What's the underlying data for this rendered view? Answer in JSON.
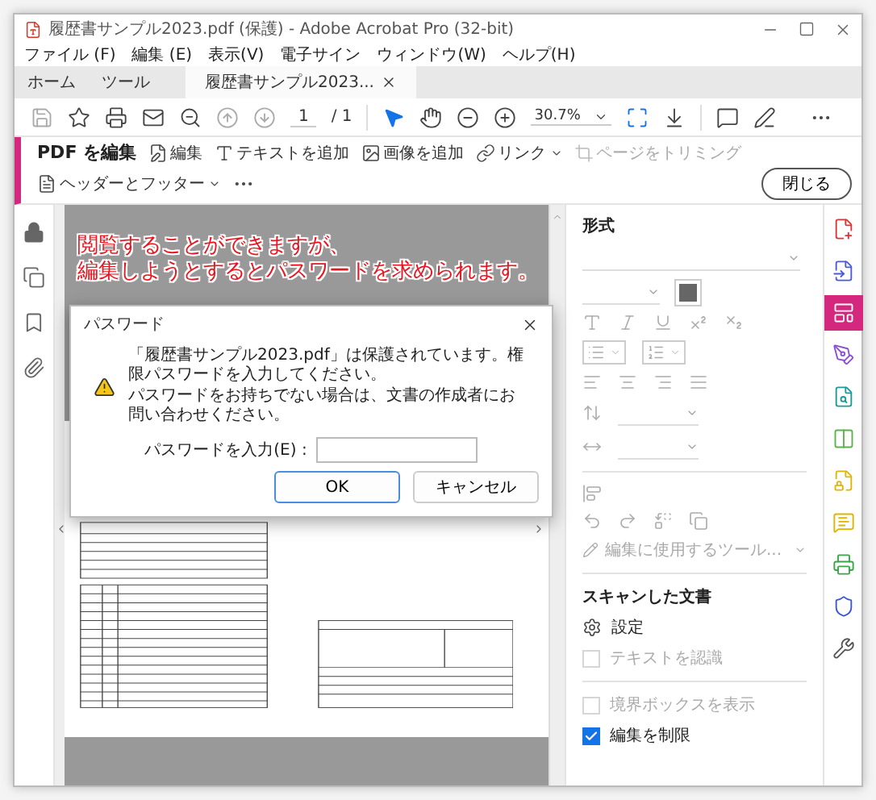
{
  "window": {
    "title": "履歴書サンプル2023.pdf (保護) - Adobe Acrobat Pro (32-bit)"
  },
  "menu": [
    "ファイル (F)",
    "編集 (E)",
    "表示(V)",
    "電子サイン",
    "ウィンドウ(W)",
    "ヘルプ(H)"
  ],
  "tabs": [
    {
      "kind": "nav",
      "label": "ホーム",
      "selected": false
    },
    {
      "kind": "nav",
      "label": "ツール",
      "selected": false
    },
    {
      "kind": "document",
      "label": "履歴書サンプル2023...",
      "selected": true
    }
  ],
  "toolbar": {
    "page": "1",
    "page_total": "/ 1",
    "zoom": "30.7%"
  },
  "edit_toolbar": {
    "title": "PDF を編集",
    "tools": [
      {
        "kind": "edit",
        "label": "編集",
        "disabled": false,
        "dropdown": false
      },
      {
        "kind": "text",
        "label": "テキストを追加",
        "disabled": false,
        "dropdown": false
      },
      {
        "kind": "image",
        "label": "画像を追加",
        "disabled": false,
        "dropdown": false
      },
      {
        "kind": "link",
        "label": "リンク",
        "disabled": false,
        "dropdown": true
      },
      {
        "kind": "crop",
        "label": "ページをトリミング",
        "disabled": true,
        "dropdown": false
      },
      {
        "kind": "header",
        "label": "ヘッダーとフッター",
        "disabled": false,
        "dropdown": true
      }
    ],
    "close": "閉じる"
  },
  "annotation": [
    "閲覧することができますが、",
    "編集しようとするとパスワードを求められます。"
  ],
  "dialog": {
    "title": "パスワード",
    "message": [
      "「履歴書サンプル2023.pdf」は保護されています。権限パスワードを入力してください。",
      "パスワードをお持ちでない場合は、文書の作成者にお問い合わせください。"
    ],
    "field_label": "パスワードを入力(E) :",
    "buttons": [
      {
        "label": "OK",
        "default": true
      },
      {
        "label": "キャンセル",
        "default": false
      }
    ]
  },
  "format_panel": {
    "heading": "形式",
    "tools_dropdown": "編集に使用するツール...",
    "scanned": {
      "heading": "スキャンした文書",
      "settings": "設定",
      "options": [
        {
          "label": "テキストを認識",
          "checked": false,
          "disabled": true
        }
      ]
    },
    "options": [
      {
        "label": "境界ボックスを表示",
        "checked": false,
        "disabled": true
      },
      {
        "label": "編集を制限",
        "checked": true,
        "disabled": false
      }
    ]
  },
  "tool_rail": [
    {
      "selected": false
    },
    {
      "selected": false
    },
    {
      "selected": true
    },
    {
      "selected": false
    },
    {
      "selected": false
    },
    {
      "selected": false
    },
    {
      "selected": false
    },
    {
      "selected": false
    },
    {
      "selected": false
    },
    {
      "selected": false
    },
    {
      "selected": false
    }
  ]
}
